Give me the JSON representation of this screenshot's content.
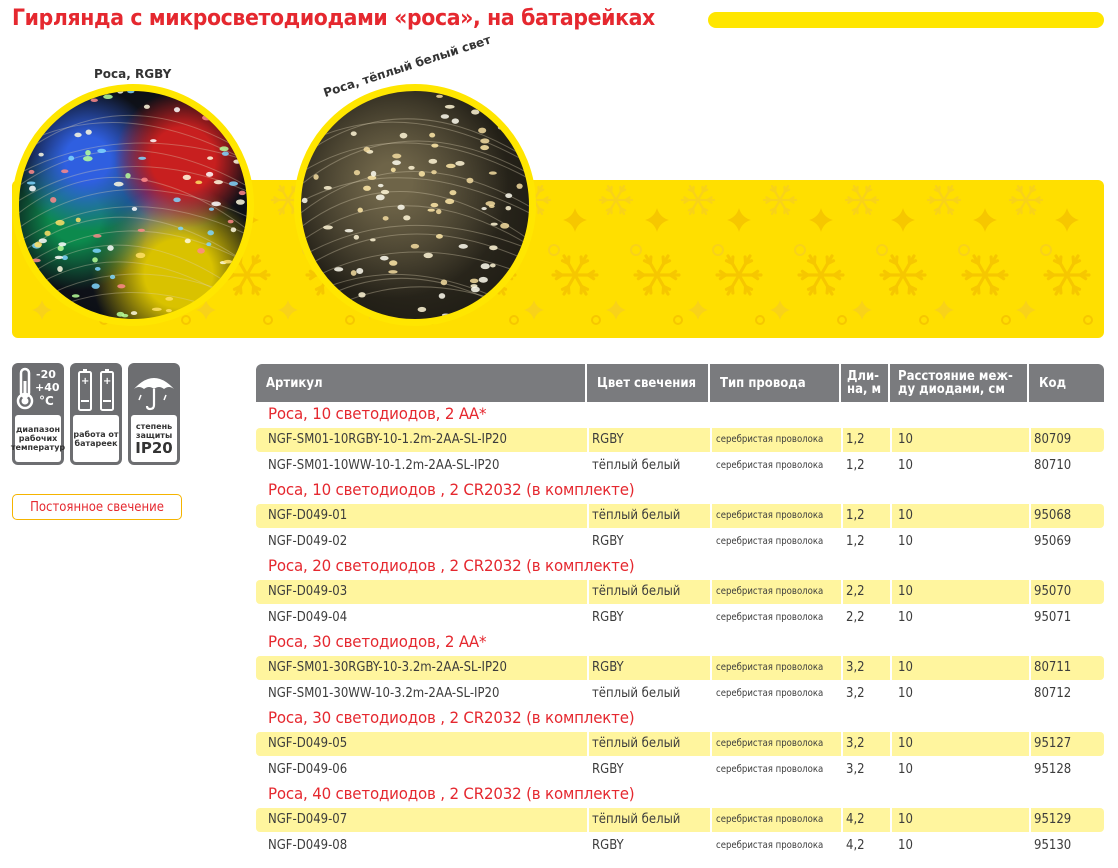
{
  "title": "Гирлянда с микросветодиодами «роса», на батарейках",
  "circles": {
    "rgb_label": "Роса, RGBY",
    "warm_label": "Роса, тёплый белый свет"
  },
  "specs": {
    "temp_range_top": "-20",
    "temp_range_bottom": "+40",
    "temp_unit": "°C",
    "temp_caption": "диапазон рабочих температур",
    "battery_caption": "работа от батареек",
    "ip_caption": "степень защиты",
    "ip_value": "IP20"
  },
  "mode_badge": "Постоянное свечение",
  "table": {
    "headers": {
      "article": "Артикул",
      "color": "Цвет свечения",
      "wire": "Тип провода",
      "length_1": "Дли-",
      "length_2": "на, м",
      "spacing_1": "Расстояние меж-",
      "spacing_2": "ду диодами, см",
      "code": "Код"
    },
    "groups": [
      {
        "title": "Роса, 10 светодиодов, 2 АА*",
        "rows": [
          {
            "article": "NGF-SM01-10RGBY-10-1.2m-2AA-SL-IP20",
            "color": "RGBY",
            "wire": "серебристая проволока",
            "length": "1,2",
            "spacing": "10",
            "code": "80709"
          },
          {
            "article": "NGF-SM01-10WW-10-1.2m-2AA-SL-IP20",
            "color": "тёплый белый",
            "wire": "серебристая проволока",
            "length": "1,2",
            "spacing": "10",
            "code": "80710"
          }
        ]
      },
      {
        "title": "Роса, 10 светодиодов , 2 CR2032 (в комплекте)",
        "rows": [
          {
            "article": "NGF-D049-01",
            "color": "тёплый белый",
            "wire": "серебристая проволока",
            "length": "1,2",
            "spacing": "10",
            "code": "95068"
          },
          {
            "article": "NGF-D049-02",
            "color": "RGBY",
            "wire": "серебристая проволока",
            "length": "1,2",
            "spacing": "10",
            "code": "95069"
          }
        ]
      },
      {
        "title": "Роса, 20 светодиодов , 2 CR2032 (в комплекте)",
        "rows": [
          {
            "article": "NGF-D049-03",
            "color": "тёплый белый",
            "wire": "серебристая проволока",
            "length": "2,2",
            "spacing": "10",
            "code": "95070"
          },
          {
            "article": "NGF-D049-04",
            "color": "RGBY",
            "wire": "серебристая проволока",
            "length": "2,2",
            "spacing": "10",
            "code": "95071"
          }
        ]
      },
      {
        "title": "Роса, 30 светодиодов, 2 АА*",
        "rows": [
          {
            "article": "NGF-SM01-30RGBY-10-3.2m-2AA-SL-IP20",
            "color": "RGBY",
            "wire": "серебристая проволока",
            "length": "3,2",
            "spacing": "10",
            "code": "80711"
          },
          {
            "article": "NGF-SM01-30WW-10-3.2m-2AA-SL-IP20",
            "color": "тёплый белый",
            "wire": "серебристая проволока",
            "length": "3,2",
            "spacing": "10",
            "code": "80712"
          }
        ]
      },
      {
        "title": "Роса, 30 светодиодов , 2 CR2032 (в комплекте)",
        "rows": [
          {
            "article": "NGF-D049-05",
            "color": "тёплый белый",
            "wire": "серебристая проволока",
            "length": "3,2",
            "spacing": "10",
            "code": "95127"
          },
          {
            "article": "NGF-D049-06",
            "color": "RGBY",
            "wire": "серебристая проволока",
            "length": "3,2",
            "spacing": "10",
            "code": "95128"
          }
        ]
      },
      {
        "title": "Роса, 40 светодиодов , 2 CR2032 (в комплекте)",
        "rows": [
          {
            "article": "NGF-D049-07",
            "color": "тёплый белый",
            "wire": "серебристая проволока",
            "length": "4,2",
            "spacing": "10",
            "code": "95129"
          },
          {
            "article": "NGF-D049-08",
            "color": "RGBY",
            "wire": "серебристая проволока",
            "length": "4,2",
            "spacing": "10",
            "code": "95130"
          }
        ]
      }
    ]
  },
  "colors": {
    "accent_red": "#e5282f",
    "brand_yellow": "#ffe600",
    "row_highlight": "#fff59e",
    "header_gray": "#7a7b7e"
  }
}
